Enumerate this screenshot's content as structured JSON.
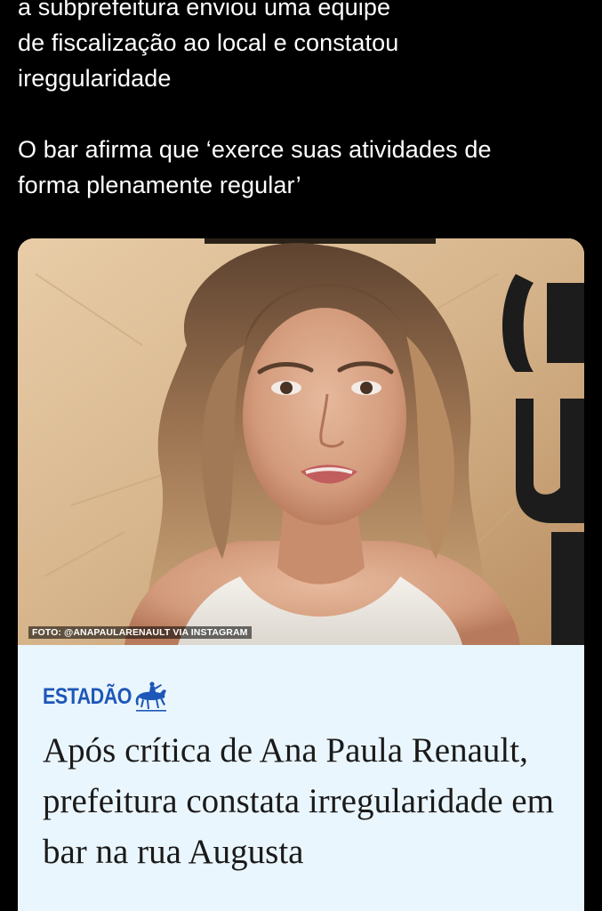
{
  "tweet": {
    "paragraph_1": "a subprefeitura enviou uma equipe\nde fiscalização ao local e constatou\nireggularidade",
    "paragraph_2": "O bar afirma que ‘exerce suas atividades de\nforma plenamente regular’"
  },
  "link_card": {
    "photo_credit": "FOTO: @ANAPAULARENAULT VIA INSTAGRAM",
    "source_name": "ESTADÃO",
    "source_logo_icon": "horse-rider-icon",
    "headline": "Após crítica de Ana Paula Renault, prefeitura constata irregularidade em bar na rua Augusta",
    "colors": {
      "card_background": "#eaf6fd",
      "brand_blue": "#1d57b8",
      "headline_text": "#1a1a1a"
    }
  }
}
